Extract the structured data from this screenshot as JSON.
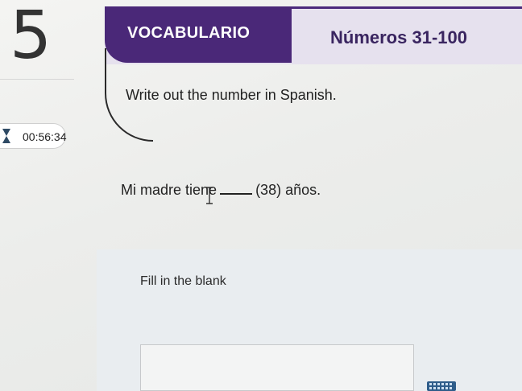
{
  "question": {
    "number": "5"
  },
  "header": {
    "category": "VOCABULARIO",
    "topic": "Números 31-100"
  },
  "instruction": "Write out the number in Spanish.",
  "timer": {
    "elapsed": "00:56:34"
  },
  "sentence": {
    "before": "Mi madre tiene",
    "after": "(38) años."
  },
  "answer": {
    "prompt": "Fill in the blank",
    "value": "",
    "placeholder": ""
  },
  "colors": {
    "header_purple": "#4a2878",
    "header_band": "#e6e1ee",
    "topic_text": "#3a2560",
    "answer_area": "#e9edf0"
  },
  "icons": [
    "hourglass-icon",
    "text-cursor-icon",
    "keyboard-icon"
  ]
}
